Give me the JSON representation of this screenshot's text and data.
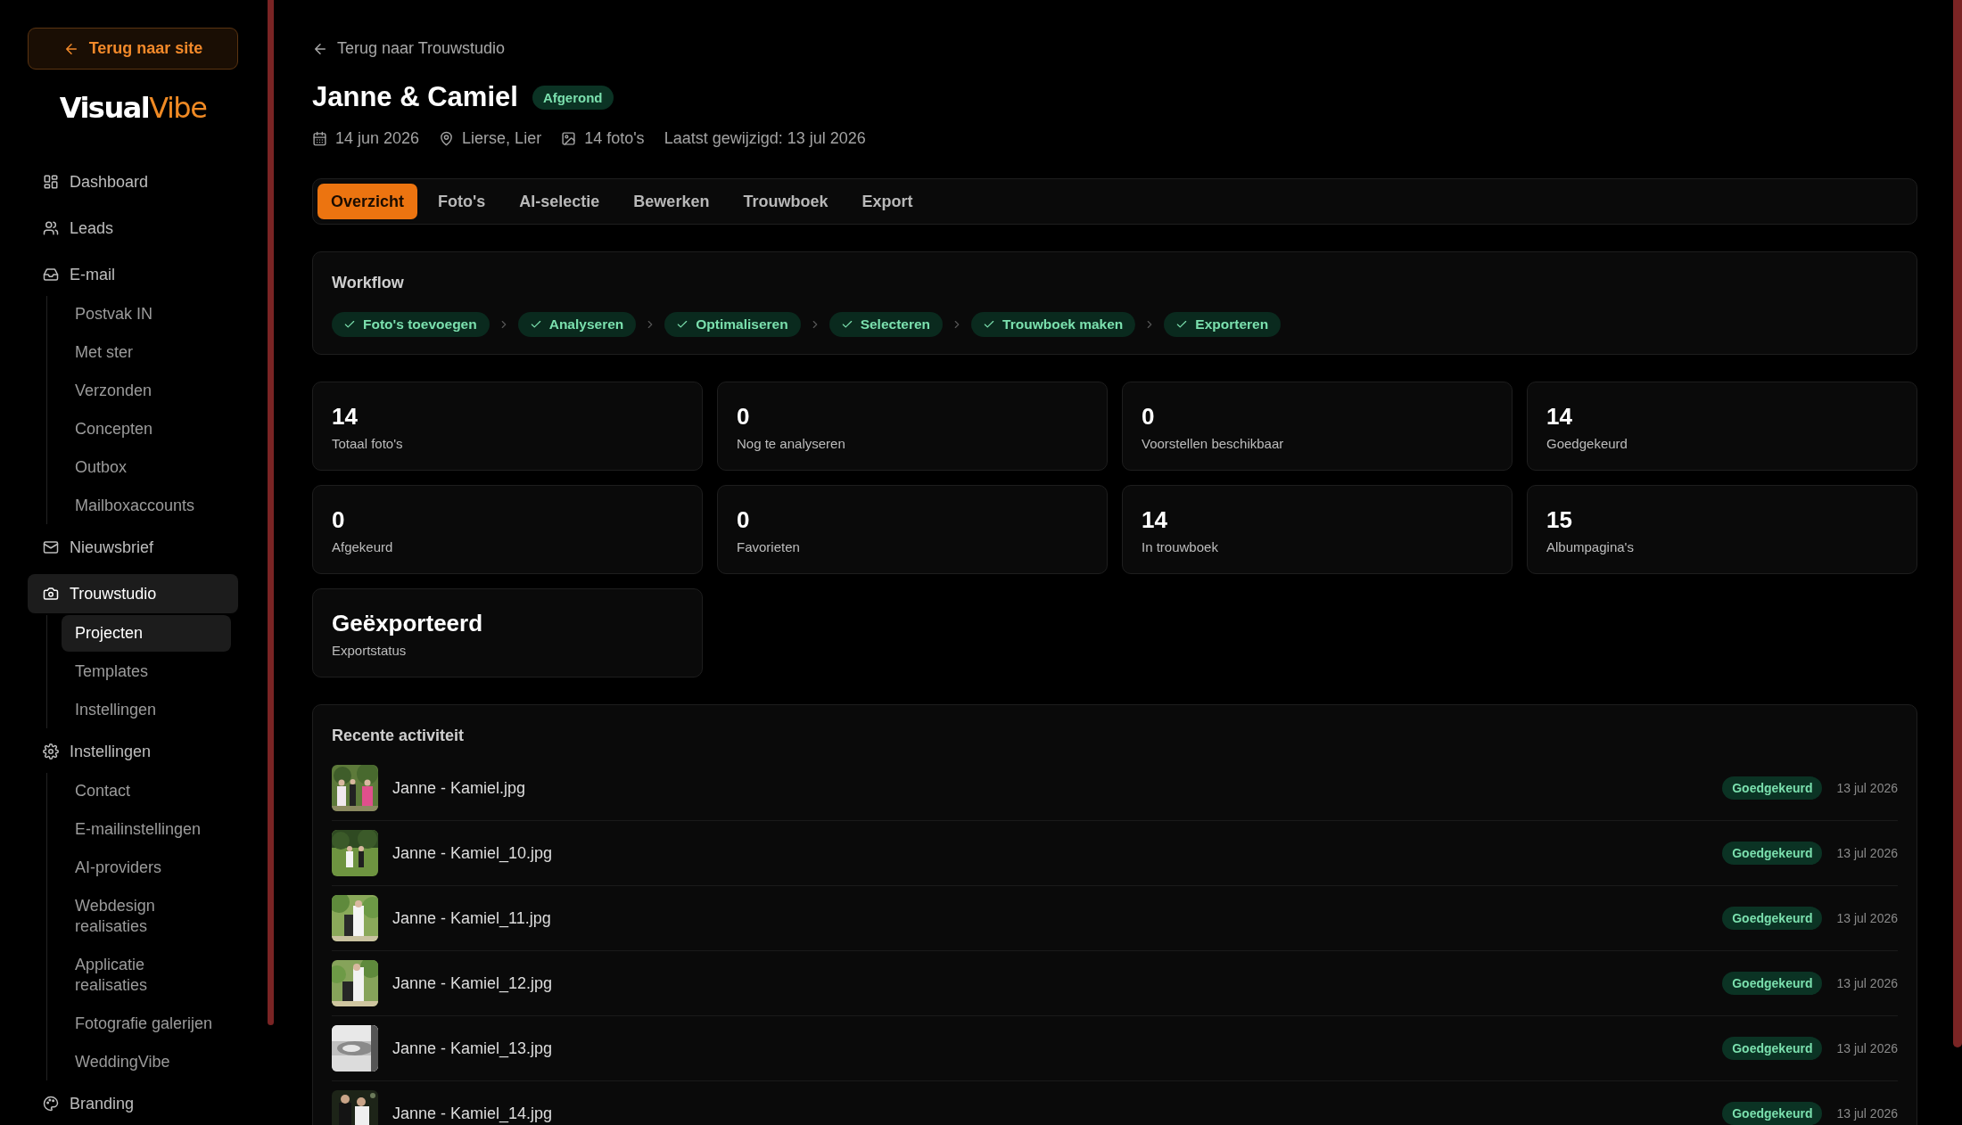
{
  "sidebar": {
    "back_button": "Terug naar site",
    "logo": {
      "first": "Visual",
      "second": "Vibe"
    },
    "items": [
      {
        "label": "Dashboard",
        "kind": "dashboard",
        "selected": false
      },
      {
        "label": "Leads",
        "kind": "people",
        "selected": false
      },
      {
        "label": "E-mail",
        "kind": "inbox",
        "selected": false,
        "children": [
          {
            "label": "Postvak IN",
            "selected": false
          },
          {
            "label": "Met ster",
            "selected": false
          },
          {
            "label": "Verzonden",
            "selected": false
          },
          {
            "label": "Concepten",
            "selected": false
          },
          {
            "label": "Outbox",
            "selected": false
          },
          {
            "label": "Mailboxaccounts",
            "selected": false
          }
        ]
      },
      {
        "label": "Nieuwsbrief",
        "kind": "newsletter",
        "selected": false
      },
      {
        "label": "Trouwstudio",
        "kind": "studio",
        "selected": true,
        "children": [
          {
            "label": "Projecten",
            "selected": true
          },
          {
            "label": "Templates",
            "selected": false
          },
          {
            "label": "Instellingen",
            "selected": false
          }
        ]
      },
      {
        "label": "Instellingen",
        "kind": "settings",
        "selected": false,
        "children": [
          {
            "label": "Contact",
            "selected": false
          },
          {
            "label": "E-mailinstellingen",
            "selected": false
          },
          {
            "label": "AI-providers",
            "selected": false
          },
          {
            "label": "Webdesign realisaties",
            "selected": false
          },
          {
            "label": "Applicatie realisaties",
            "selected": false
          },
          {
            "label": "Fotografie galerijen",
            "selected": false
          },
          {
            "label": "WeddingVibe",
            "selected": false
          }
        ]
      },
      {
        "label": "Branding",
        "kind": "branding",
        "selected": false
      }
    ]
  },
  "header": {
    "back_link": "Terug naar Trouwstudio",
    "title": "Janne & Camiel",
    "status": "Afgerond",
    "meta": [
      {
        "kind": "date",
        "text": "14 jun 2026"
      },
      {
        "kind": "location",
        "text": "Lierse, Lier"
      },
      {
        "kind": "photos",
        "text": "14 foto's"
      },
      {
        "kind": "modified",
        "text": "Laatst gewijzigd: 13 jul 2026"
      }
    ]
  },
  "tabs": [
    {
      "label": "Overzicht",
      "selected": true
    },
    {
      "label": "Foto's",
      "selected": false
    },
    {
      "label": "AI-selectie",
      "selected": false
    },
    {
      "label": "Bewerken",
      "selected": false
    },
    {
      "label": "Trouwboek",
      "selected": false
    },
    {
      "label": "Export",
      "selected": false
    }
  ],
  "workflow": {
    "title": "Workflow",
    "steps": [
      {
        "label": "Foto's toevoegen",
        "done": true
      },
      {
        "label": "Analyseren",
        "done": true
      },
      {
        "label": "Optimaliseren",
        "done": true
      },
      {
        "label": "Selecteren",
        "done": true
      },
      {
        "label": "Trouwboek maken",
        "done": true
      },
      {
        "label": "Exporteren",
        "done": true
      }
    ]
  },
  "stats": [
    {
      "value": "14",
      "label": "Totaal foto's"
    },
    {
      "value": "0",
      "label": "Nog te analyseren"
    },
    {
      "value": "0",
      "label": "Voorstellen beschikbaar"
    },
    {
      "value": "14",
      "label": "Goedgekeurd"
    },
    {
      "value": "0",
      "label": "Afgekeurd"
    },
    {
      "value": "0",
      "label": "Favorieten"
    },
    {
      "value": "14",
      "label": "In trouwboek"
    },
    {
      "value": "15",
      "label": "Albumpagina's"
    },
    {
      "value": "Geëxporteerd",
      "label": "Exportstatus"
    }
  ],
  "activity": {
    "title": "Recente activiteit",
    "rows": [
      {
        "file": "Janne - Kamiel.jpg",
        "status": "Goedgekeurd",
        "date": "13 jul 2026"
      },
      {
        "file": "Janne - Kamiel_10.jpg",
        "status": "Goedgekeurd",
        "date": "13 jul 2026"
      },
      {
        "file": "Janne - Kamiel_11.jpg",
        "status": "Goedgekeurd",
        "date": "13 jul 2026"
      },
      {
        "file": "Janne - Kamiel_12.jpg",
        "status": "Goedgekeurd",
        "date": "13 jul 2026"
      },
      {
        "file": "Janne - Kamiel_13.jpg",
        "status": "Goedgekeurd",
        "date": "13 jul 2026"
      },
      {
        "file": "Janne - Kamiel_14.jpg",
        "status": "Goedgekeurd",
        "date": "13 jul 2026"
      }
    ]
  }
}
